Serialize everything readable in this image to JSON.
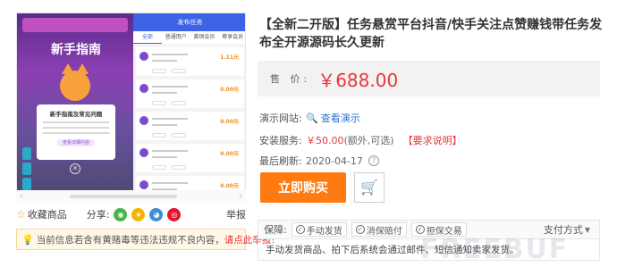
{
  "gallery": {
    "left_title": "新手指南",
    "modal_title": "新手指南及常见问题",
    "modal_button": "查看详细内容",
    "right_header": "发布任务",
    "right_tabs": [
      "全部",
      "普通用户",
      "黄铜会员",
      "尊享会员"
    ],
    "prices": [
      "1.11元",
      "0.00元",
      "0.00元",
      "0.00元",
      "0.00元"
    ]
  },
  "actions": {
    "favorite": "收藏商品",
    "share_label": "分享:",
    "report": "举报"
  },
  "notice": {
    "text": "当前信息若含有黄赌毒等违法违规不良内容，",
    "link": "请点此举报!"
  },
  "product": {
    "title": "【全新二开版】任务悬赏平台抖音/快手关注点赞赚钱带任务发布全开源源码长久更新",
    "price_label": "售 价:",
    "price": "￥688.00",
    "demo_label": "演示网站:",
    "demo_link": "查看演示",
    "service_label": "安装服务:",
    "service_price": "￥50.00",
    "service_note": "(额外,可选)",
    "service_link": "【要求说明】",
    "updated_label": "最后刷新:",
    "updated_date": "2020-04-17",
    "buy_button": "立即购买"
  },
  "guarantee": {
    "label": "保障:",
    "chips": [
      "手动发货",
      "消保赔付",
      "担保交易"
    ],
    "payment": "支付方式",
    "description": "手动发货商品、拍下后系统会通过邮件、短信通知卖家发货。"
  },
  "colors": {
    "price_red": "#e4393c",
    "buy_orange": "#ff7a10",
    "link_blue": "#2e74d6"
  }
}
